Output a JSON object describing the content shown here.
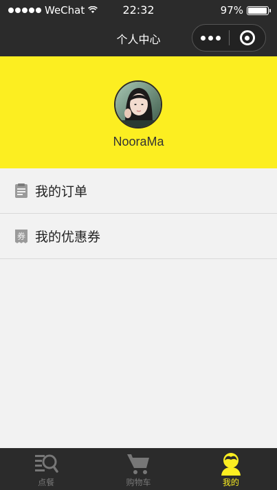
{
  "status_bar": {
    "carrier": "WeChat",
    "time": "22:32",
    "battery": "97%",
    "battery_level": 0.97
  },
  "nav": {
    "title": "个人中心"
  },
  "profile": {
    "username": "NooraMa"
  },
  "menu": {
    "items": [
      {
        "label": "我的订单",
        "icon": "order-icon"
      },
      {
        "label": "我的优惠券",
        "icon": "coupon-icon",
        "badge": "券"
      }
    ]
  },
  "tab_bar": {
    "tabs": [
      {
        "label": "点餐",
        "icon": "menu-search-icon",
        "active": false
      },
      {
        "label": "购物车",
        "icon": "cart-icon",
        "active": false
      },
      {
        "label": "我的",
        "icon": "user-icon",
        "active": true
      }
    ]
  },
  "colors": {
    "accent": "#fcee21",
    "dark": "#2b2b2b",
    "background": "#f2f2f2"
  }
}
